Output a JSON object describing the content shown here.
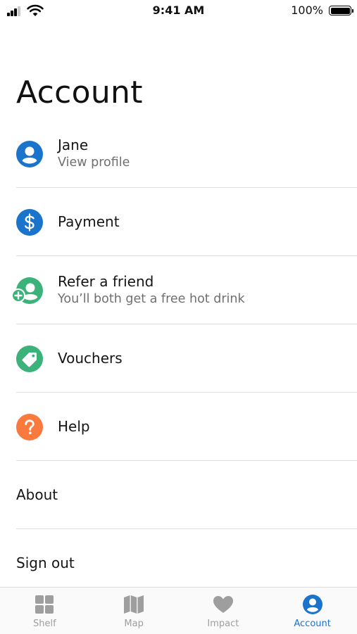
{
  "status_bar": {
    "time": "9:41 AM",
    "battery": "100%"
  },
  "page": {
    "title": "Account"
  },
  "menu": [
    {
      "label": "Jane",
      "subtitle": "View profile",
      "icon": "user-icon",
      "color": "#1a74cc"
    },
    {
      "label": "Payment",
      "subtitle": "",
      "icon": "dollar-icon",
      "color": "#1a74cc"
    },
    {
      "label": "Refer a friend",
      "subtitle": "You’ll both get a free hot drink",
      "icon": "add-friend-icon",
      "color": "#3bb27a"
    },
    {
      "label": "Vouchers",
      "subtitle": "",
      "icon": "tag-icon",
      "color": "#3bb27a"
    },
    {
      "label": "Help",
      "subtitle": "",
      "icon": "question-icon",
      "color": "#fa7a3e"
    },
    {
      "label": "About",
      "subtitle": "",
      "icon": "",
      "color": ""
    },
    {
      "label": "Sign out",
      "subtitle": "",
      "icon": "",
      "color": ""
    }
  ],
  "tabs": [
    {
      "label": "Shelf",
      "icon": "grid-icon",
      "active": false
    },
    {
      "label": "Map",
      "icon": "map-icon",
      "active": false
    },
    {
      "label": "Impact",
      "icon": "heart-icon",
      "active": false
    },
    {
      "label": "Account",
      "icon": "account-icon",
      "active": true
    }
  ],
  "colors": {
    "accent": "#1a74cc",
    "green": "#3bb27a",
    "orange": "#fa7a3e",
    "inactive_tab": "#9e9e9e",
    "active_tab": "#1a74cc"
  }
}
